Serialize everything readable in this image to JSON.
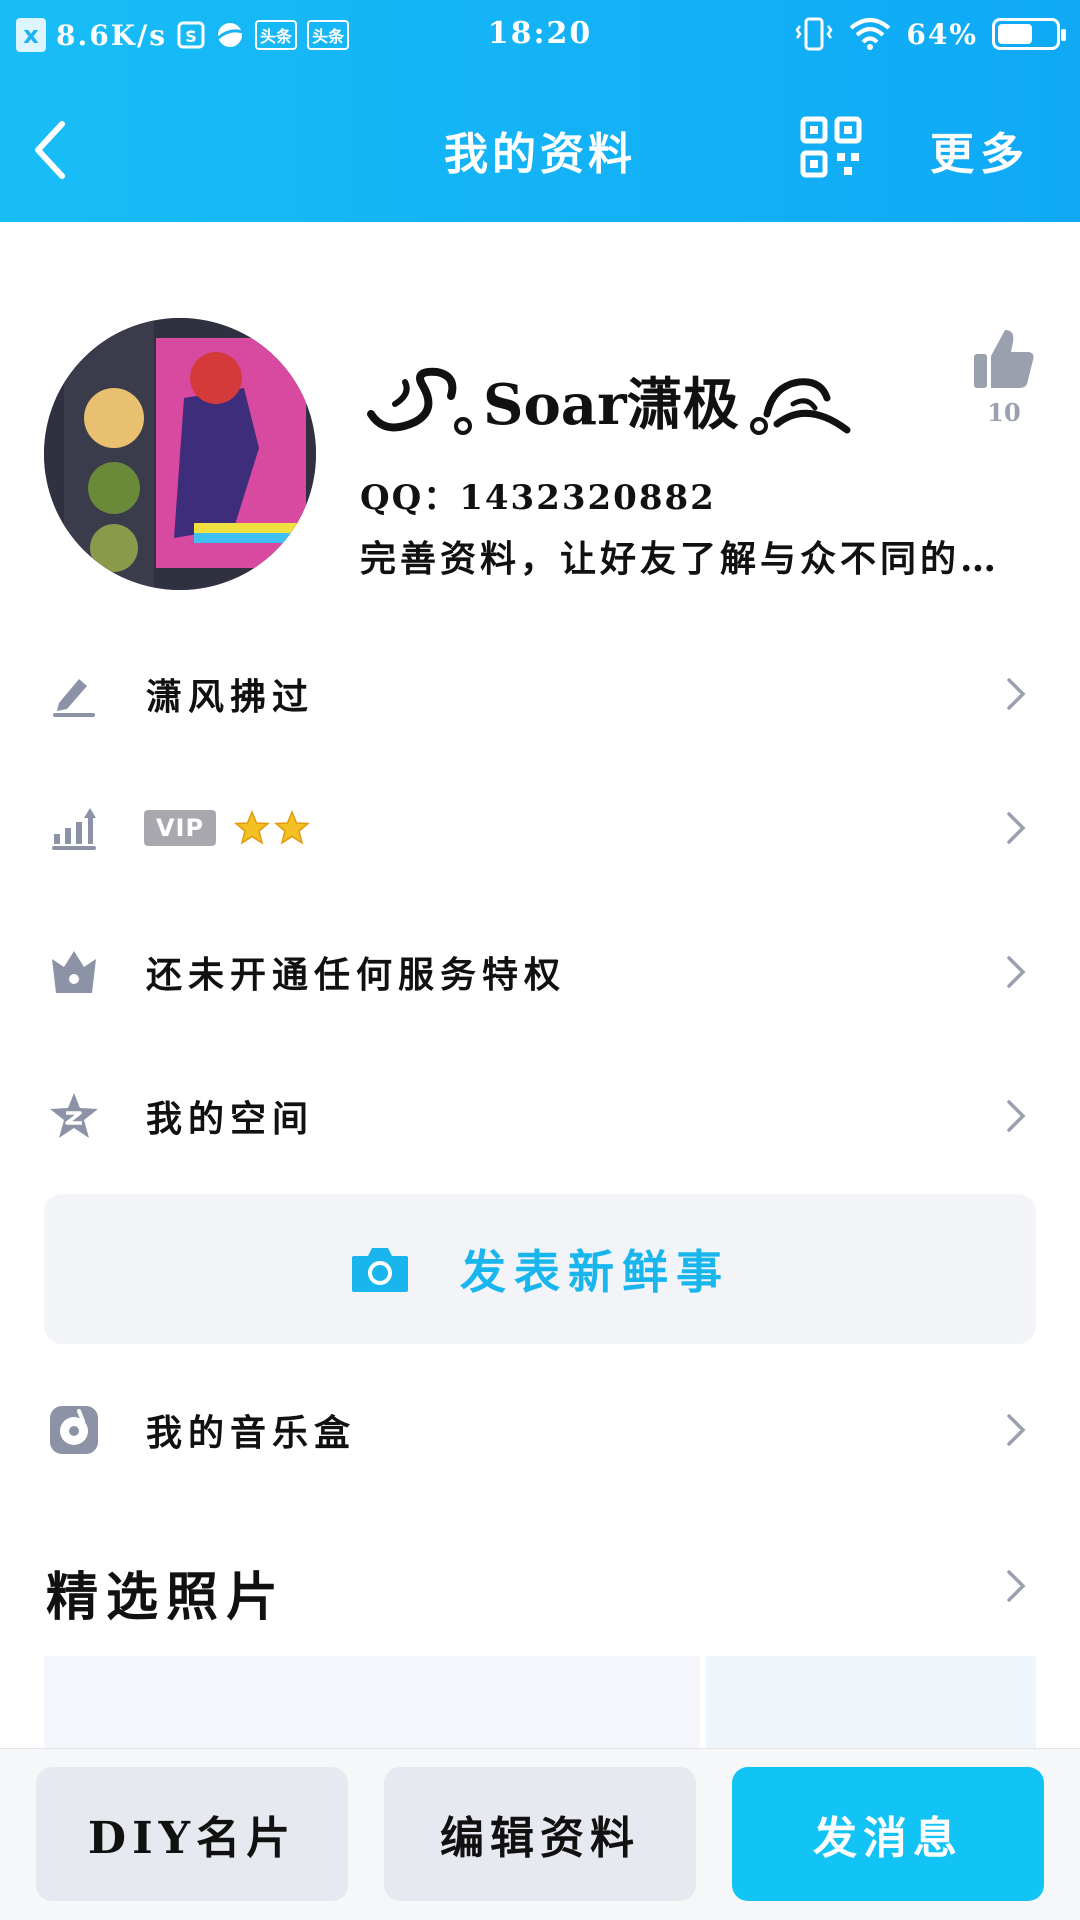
{
  "status_bar": {
    "speed": "8.6K/s",
    "app_icon_1": "头条",
    "app_icon_2": "头条",
    "time": "18:20",
    "battery": "64%",
    "battery_level": 0.64
  },
  "header": {
    "title": "我的资料",
    "more": "更多"
  },
  "profile": {
    "nickname": "Soar潇极",
    "qq": "QQ：1432320882",
    "description": "完善资料，让好友了解与众不同的…",
    "like_count": "10"
  },
  "rows": [
    {
      "label": "潇风拂过",
      "icon": "pencil-icon"
    },
    {
      "badge": "VIP",
      "stars": 2,
      "icon": "level-up-icon"
    },
    {
      "label": "还未开通任何服务特权",
      "icon": "crown-icon"
    },
    {
      "label": "我的空间",
      "icon": "qzone-star-icon"
    }
  ],
  "post_button": {
    "label": "发表新鲜事",
    "icon": "camera-icon"
  },
  "music_row": {
    "label": "我的音乐盒",
    "icon": "music-disc-icon"
  },
  "photos_section": {
    "title": "精选照片"
  },
  "bottom_bar": {
    "diy": "DIY名片",
    "edit": "编辑资料",
    "send": "发消息"
  },
  "colors": {
    "header": "#12b3f6",
    "accent": "#19b6ee",
    "send_button": "#12c3f6",
    "icon_gray": "#8c93a6"
  }
}
